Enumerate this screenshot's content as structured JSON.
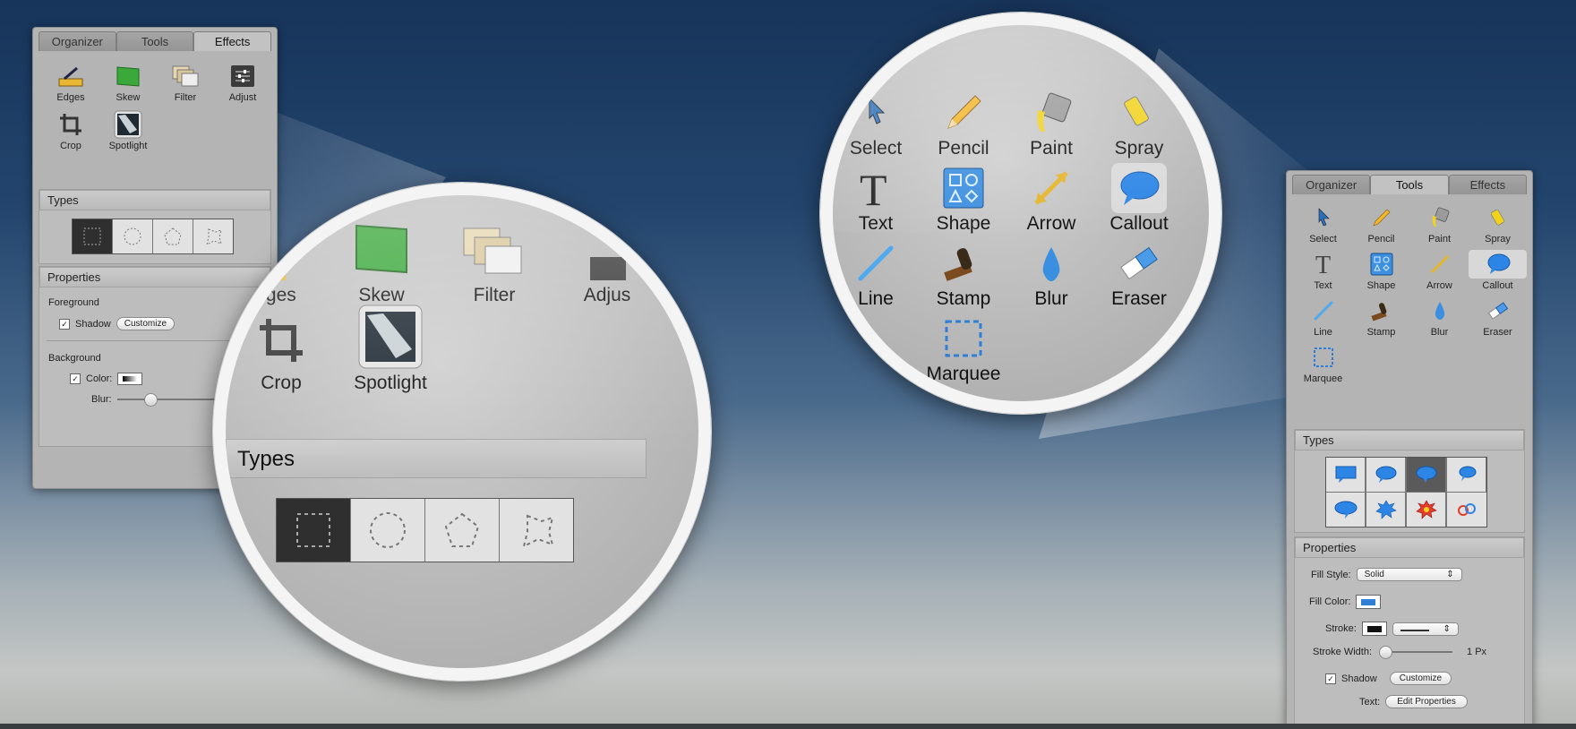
{
  "left_panel": {
    "tabs": [
      "Organizer",
      "Tools",
      "Effects"
    ],
    "tools": [
      "Edges",
      "Skew",
      "Filter",
      "Adjust",
      "Crop",
      "Spotlight"
    ],
    "types_title": "Types",
    "properties_title": "Properties",
    "foreground_label": "Foreground",
    "shadow_label": "Shadow",
    "customize_label": "Customize",
    "background_label": "Background",
    "color_label": "Color:",
    "blur_label": "Blur:"
  },
  "left_lens": {
    "tools": [
      "dges",
      "Skew",
      "Filter",
      "Adjus",
      "Crop",
      "Spotlight"
    ],
    "types_title": "Types"
  },
  "right_lens": {
    "tools": [
      "Select",
      "Pencil",
      "Paint",
      "Spray",
      "Text",
      "Shape",
      "Arrow",
      "Callout",
      "Line",
      "Stamp",
      "Blur",
      "Eraser",
      "Marquee"
    ]
  },
  "right_panel": {
    "tabs": [
      "Organizer",
      "Tools",
      "Effects"
    ],
    "tools": [
      "Select",
      "Pencil",
      "Paint",
      "Spray",
      "Text",
      "Shape",
      "Arrow",
      "Callout",
      "Line",
      "Stamp",
      "Blur",
      "Eraser",
      "Marquee"
    ],
    "types_title": "Types",
    "properties_title": "Properties",
    "fill_style_label": "Fill Style:",
    "fill_style_value": "Solid",
    "fill_color_label": "Fill Color:",
    "stroke_label": "Stroke:",
    "stroke_width_label": "Stroke Width:",
    "stroke_width_value": "1 Px",
    "shadow_label": "Shadow",
    "customize_label": "Customize",
    "text_label": "Text:",
    "edit_properties_label": "Edit Properties"
  },
  "colors": {
    "accent_blue": "#2f7fd6",
    "skew_green": "#3aa83a"
  }
}
